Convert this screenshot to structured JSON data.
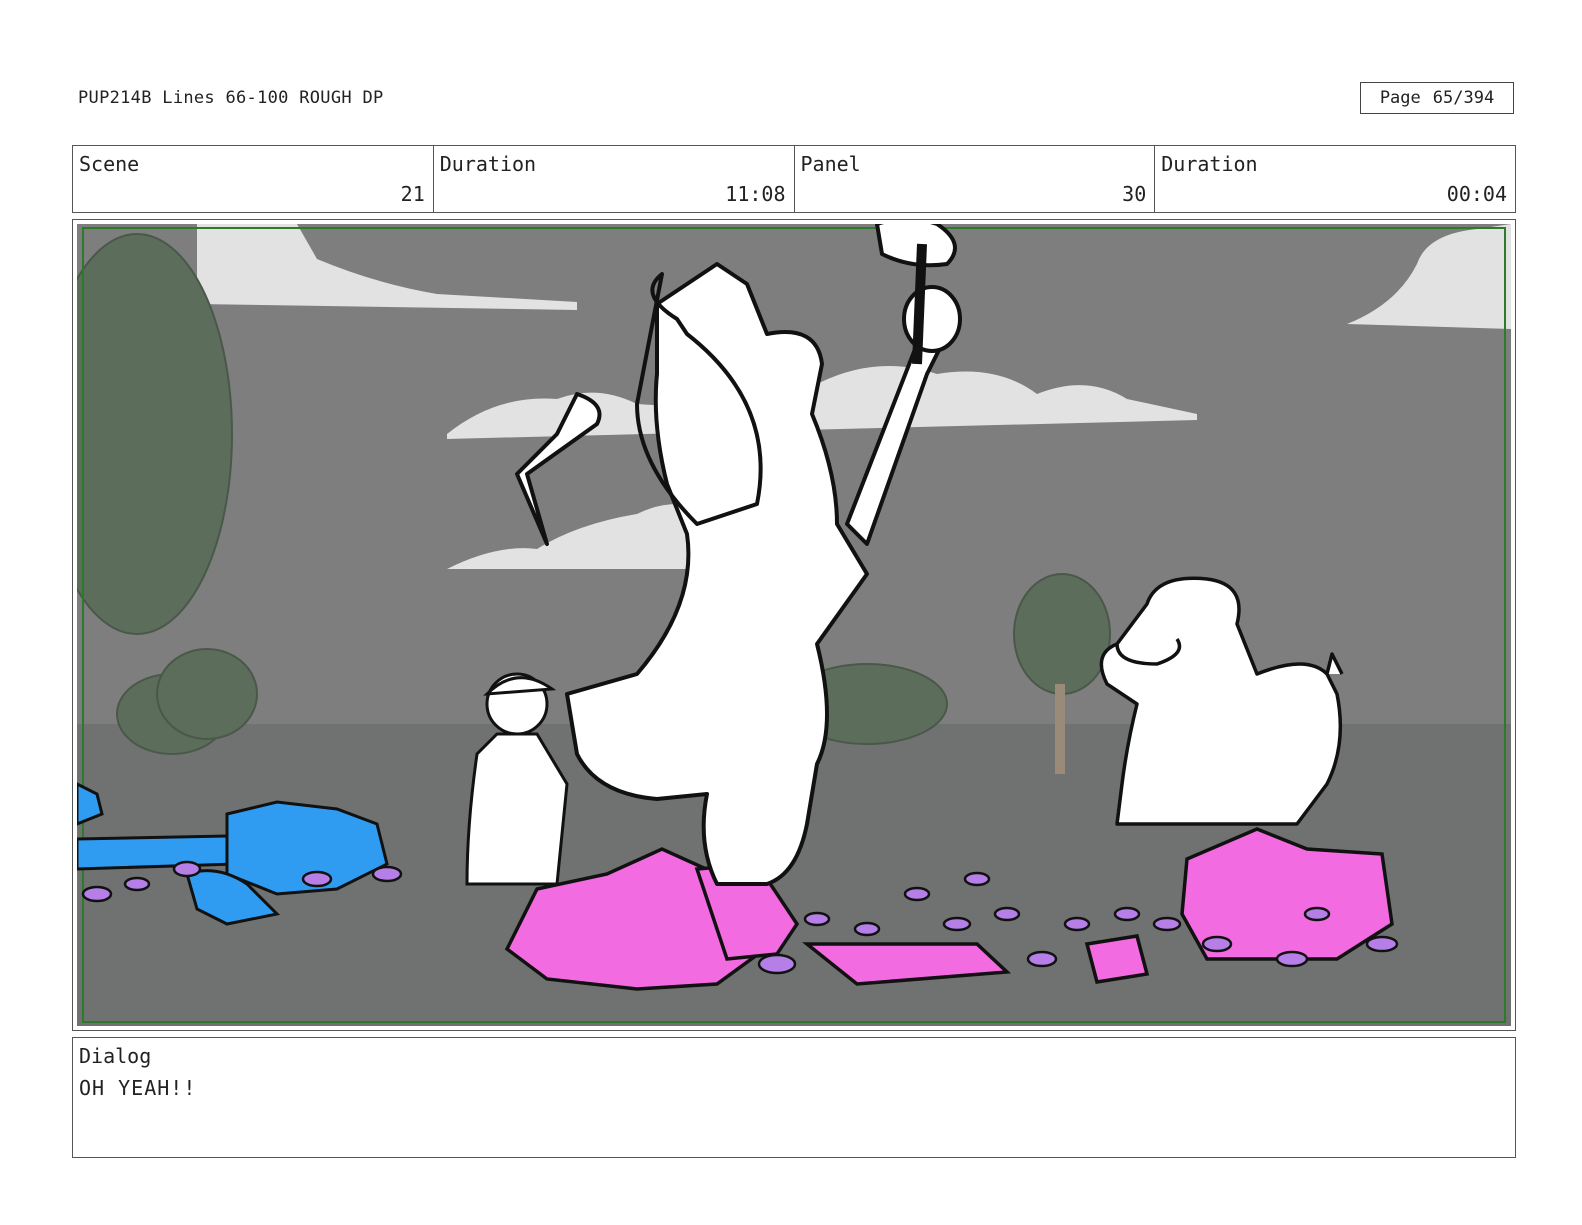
{
  "header": {
    "title": "PUP214B Lines 66-100 ROUGH DP",
    "page_label": "Page",
    "page_number": "65/394"
  },
  "info": {
    "scene_label": "Scene",
    "scene_value": "21",
    "scene_duration_label": "Duration",
    "scene_duration_value": "11:08",
    "panel_label": "Panel",
    "panel_value": "30",
    "panel_duration_label": "Duration",
    "panel_duration_value": "00:04"
  },
  "panel": {
    "colors": {
      "sky": "#7e7e7e",
      "ground": "#6f6f6f",
      "clouds": "#e2e2e2",
      "trees": "#5c6d5c",
      "pink_rocks": "#f26be0",
      "blue_rocks": "#2f9cf2",
      "pebbles": "#b67fe8",
      "frame_border": "#2d7a2d"
    }
  },
  "dialog": {
    "label": "Dialog",
    "text": "OH YEAH!!"
  }
}
